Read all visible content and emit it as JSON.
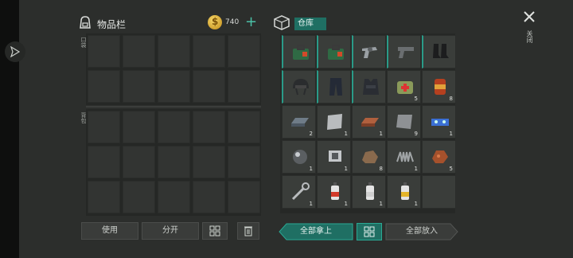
{
  "inventory": {
    "title": "物品栏",
    "currency_value": "740",
    "currency_symbol": "$",
    "add_label": "+",
    "pocket_label": "口袋",
    "backpack_label": "背包",
    "use_button": "使用",
    "split_button": "分开"
  },
  "warehouse": {
    "title": "仓库",
    "take_all_button": "全部拿上",
    "put_all_button": "全部放入",
    "items": [
      {
        "name": "medkit-bag-icon",
        "qty": ""
      },
      {
        "name": "medkit-bag-icon",
        "qty": ""
      },
      {
        "name": "revolver-icon",
        "qty": ""
      },
      {
        "name": "pistol-icon",
        "qty": ""
      },
      {
        "name": "boots-icon",
        "qty": ""
      },
      {
        "name": "helmet-icon",
        "qty": ""
      },
      {
        "name": "pants-icon",
        "qty": ""
      },
      {
        "name": "vest-icon",
        "qty": ""
      },
      {
        "name": "first-aid-kit-icon",
        "qty": "5"
      },
      {
        "name": "canned-food-icon",
        "qty": "8"
      },
      {
        "name": "steel-ingot-icon",
        "qty": "2"
      },
      {
        "name": "metal-plate-icon",
        "qty": "1"
      },
      {
        "name": "copper-ingot-icon",
        "qty": "1"
      },
      {
        "name": "lead-plate-icon",
        "qty": "9"
      },
      {
        "name": "circuit-board-icon",
        "qty": "1"
      },
      {
        "name": "lens-icon",
        "qty": "1"
      },
      {
        "name": "engine-part-icon",
        "qty": "1"
      },
      {
        "name": "ore-icon",
        "qty": "8"
      },
      {
        "name": "spring-icon",
        "qty": "1"
      },
      {
        "name": "copper-ore-icon",
        "qty": "5"
      },
      {
        "name": "wrench-icon",
        "qty": "1"
      },
      {
        "name": "red-spray-can-icon",
        "qty": "1"
      },
      {
        "name": "white-spray-can-icon",
        "qty": "1"
      },
      {
        "name": "yellow-spray-can-icon",
        "qty": "1"
      },
      {
        "name": "empty-slot",
        "qty": ""
      }
    ]
  },
  "close_label": "关闭",
  "colors": {
    "accent": "#2a9b88",
    "coin": "#e2b43a",
    "panel": "#252725"
  }
}
